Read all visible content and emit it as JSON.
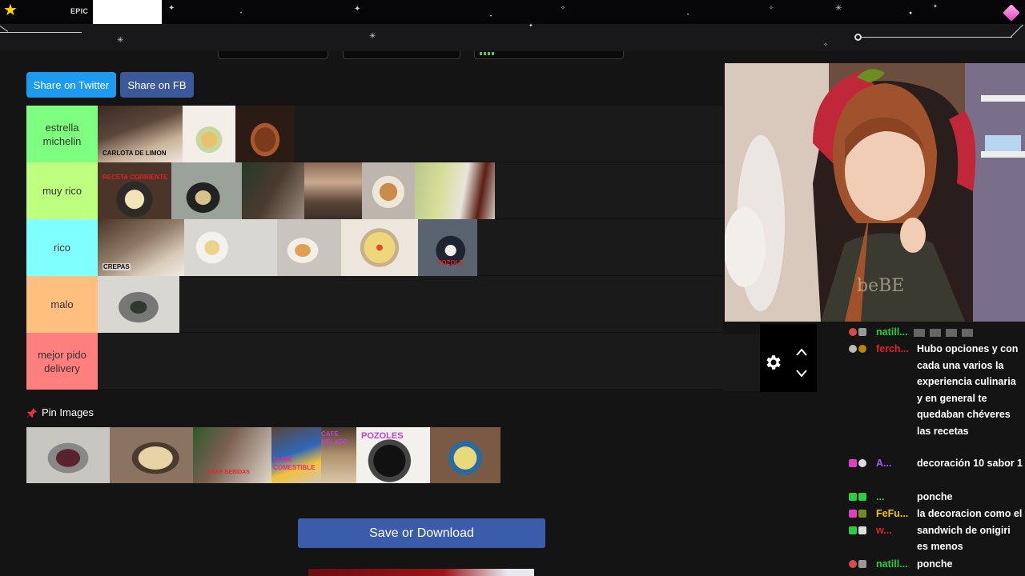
{
  "overlay": {
    "top_label": "EPIC"
  },
  "share": {
    "twitter_label": "Share on Twitter",
    "fb_label": "Share on FB"
  },
  "tiers": [
    {
      "label": "estrella michelin",
      "color": "#7fff7f",
      "captions": [
        "CARLOTA DE LIMON"
      ]
    },
    {
      "label": "muy rico",
      "color": "#bfff7f",
      "captions": [
        "RECETA CORRIENTE"
      ]
    },
    {
      "label": "rico",
      "color": "#7fffff",
      "captions": [
        "CREPAS",
        "POZOLE"
      ]
    },
    {
      "label": "malo",
      "color": "#ffbf7f",
      "captions": []
    },
    {
      "label": "mejor pido delivery",
      "color": "#ff7f7f",
      "captions": []
    }
  ],
  "pin": {
    "title": "Pin Images",
    "captions": [
      "SAKE BEBIDAS",
      "SLIME COMESTIBLE",
      "CAFE HELADO",
      "POZOLES"
    ]
  },
  "save_label": "Save or Download",
  "chat": {
    "messages": [
      {
        "user": "natill...",
        "user_color": "#2ecc40",
        "text": ""
      },
      {
        "user": "ferch...",
        "user_color": "#e0202a",
        "text": "Hubo opciones y con cada una varios la experiencia culinaria y en general te quedaban chéveres las recetas"
      },
      {
        "user": "A...",
        "user_color": "#9b59ff",
        "text": "decoración 10 sabor 1"
      },
      {
        "user": "...",
        "user_color": "#2ecc40",
        "text": "ponche"
      },
      {
        "user": "FeFu...",
        "user_color": "#f1c40f",
        "text": "la decoracion como el sandwich de onigiri es menos"
      },
      {
        "user": "w...",
        "user_color": "#e0202a",
        "text": ""
      },
      {
        "user": "natill...",
        "user_color": "#2ecc40",
        "text": "ponche"
      }
    ]
  },
  "icons": {
    "star": "star-icon",
    "gem": "gem-icon",
    "gear": "gear-icon",
    "up": "chevron-up-icon",
    "down": "chevron-down-icon",
    "pin": "pin-icon"
  }
}
